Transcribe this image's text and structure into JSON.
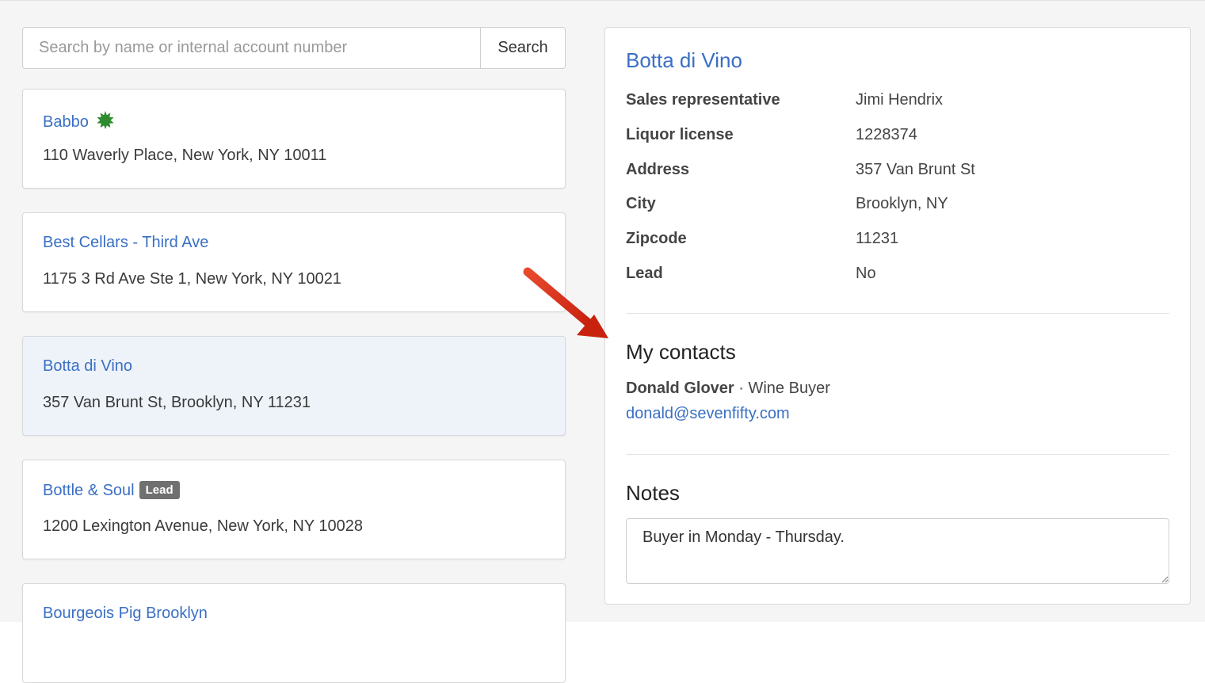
{
  "search": {
    "placeholder": "Search by name or internal account number",
    "value": "",
    "button_label": "Search"
  },
  "accounts": [
    {
      "name": "Babbo",
      "address": "110 Waverly Place, New York, NY 10011",
      "icon": "star-badge-icon",
      "icon_color": "#2e8b2e"
    },
    {
      "name": "Best Cellars - Third Ave",
      "address": "1175 3 Rd Ave Ste 1, New York, NY 10021"
    },
    {
      "name": "Botta di Vino",
      "address": "357 Van Brunt St, Brooklyn, NY 11231",
      "selected": true
    },
    {
      "name": "Bottle & Soul",
      "badge": "Lead",
      "address": "1200 Lexington Avenue, New York, NY 10028"
    },
    {
      "name": "Bourgeois Pig Brooklyn",
      "address": ""
    }
  ],
  "detail": {
    "title": "Botta di Vino",
    "fields": [
      {
        "label": "Sales representative",
        "value": "Jimi Hendrix"
      },
      {
        "label": "Liquor license",
        "value": "1228374"
      },
      {
        "label": "Address",
        "value": "357 Van Brunt St"
      },
      {
        "label": "City",
        "value": "Brooklyn, NY"
      },
      {
        "label": "Zipcode",
        "value": "11231"
      },
      {
        "label": "Lead",
        "value": "No"
      }
    ],
    "contacts_heading": "My contacts",
    "contact": {
      "name": "Donald Glover",
      "separator": " · ",
      "role": "Wine Buyer",
      "email": "donald@sevenfifty.com"
    },
    "notes_heading": "Notes",
    "notes_value": "Buyer in Monday - Thursday."
  },
  "colors": {
    "link": "#3a6fc4",
    "selected_card": "#eef3fa",
    "badge": "#707070",
    "annotation_arrow": "#d9301e"
  }
}
